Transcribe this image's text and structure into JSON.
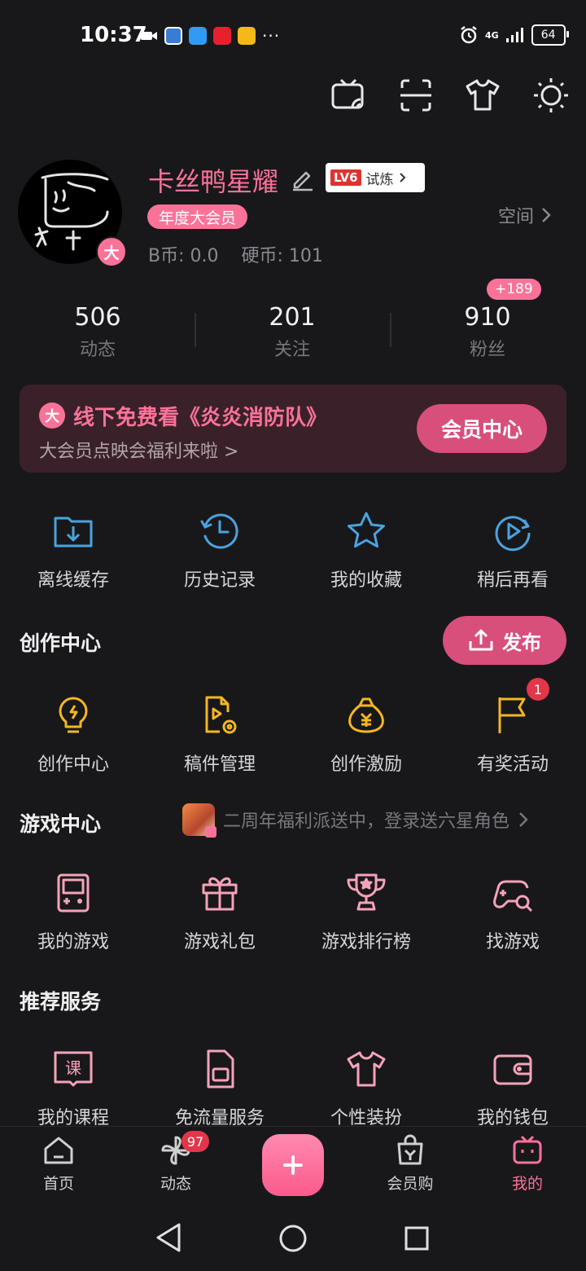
{
  "status_bar": {
    "time": "10:37",
    "network": "4G",
    "battery": "64"
  },
  "profile": {
    "username": "卡丝鸭星耀",
    "level_badge": "LV6",
    "level_status": "试炼",
    "vip_label": "年度大会员",
    "vip_avatar_mark": "大",
    "coins_text": "B币: 0.0    硬币: 101",
    "space_link": "空间"
  },
  "stats": [
    {
      "value": "506",
      "label": "动态"
    },
    {
      "value": "201",
      "label": "关注"
    },
    {
      "value": "910",
      "label": "粉丝"
    }
  ],
  "fans_increment": "+189",
  "banner": {
    "icon": "大",
    "title": "线下免费看《炎炎消防队》",
    "subtitle": "大会员点映会福利来啦 >",
    "button": "会员中心"
  },
  "quick_actions": [
    {
      "label": "离线缓存",
      "icon": "download-folder-icon"
    },
    {
      "label": "历史记录",
      "icon": "history-clock-icon"
    },
    {
      "label": "我的收藏",
      "icon": "star-icon"
    },
    {
      "label": "稍后再看",
      "icon": "watch-later-icon"
    }
  ],
  "creation": {
    "title": "创作中心",
    "publish_button": "发布",
    "items": [
      {
        "label": "创作中心",
        "icon": "lightbulb-icon"
      },
      {
        "label": "稿件管理",
        "icon": "manuscript-icon"
      },
      {
        "label": "创作激励",
        "icon": "money-bag-icon"
      },
      {
        "label": "有奖活动",
        "icon": "flag-icon",
        "badge": "1"
      }
    ]
  },
  "game": {
    "title": "游戏中心",
    "promo": "二周年福利派送中，登录送六星角色",
    "items": [
      {
        "label": "我的游戏",
        "icon": "gameboy-icon"
      },
      {
        "label": "游戏礼包",
        "icon": "gift-icon"
      },
      {
        "label": "游戏排行榜",
        "icon": "trophy-icon"
      },
      {
        "label": "找游戏",
        "icon": "gamepad-search-icon"
      }
    ]
  },
  "services": {
    "title": "推荐服务",
    "items": [
      {
        "label": "我的课程",
        "icon": "course-book-icon",
        "icon_text": "课"
      },
      {
        "label": "免流量服务",
        "icon": "sim-card-icon"
      },
      {
        "label": "个性装扮",
        "icon": "tshirt-icon"
      },
      {
        "label": "我的钱包",
        "icon": "wallet-icon"
      }
    ]
  },
  "bottom_nav": [
    {
      "label": "首页",
      "icon": "home-icon"
    },
    {
      "label": "动态",
      "icon": "pinwheel-icon",
      "badge": "97"
    },
    {
      "label": "",
      "icon": "plus-icon"
    },
    {
      "label": "会员购",
      "icon": "shopping-bag-icon"
    },
    {
      "label": "我的",
      "icon": "tv-icon",
      "active": true
    }
  ],
  "colors": {
    "accent": "#fb7299",
    "game_accent": "#f5a3b8",
    "icon_blue": "#4aa3df",
    "icon_yellow": "#f5b621",
    "background": "#18181b"
  }
}
